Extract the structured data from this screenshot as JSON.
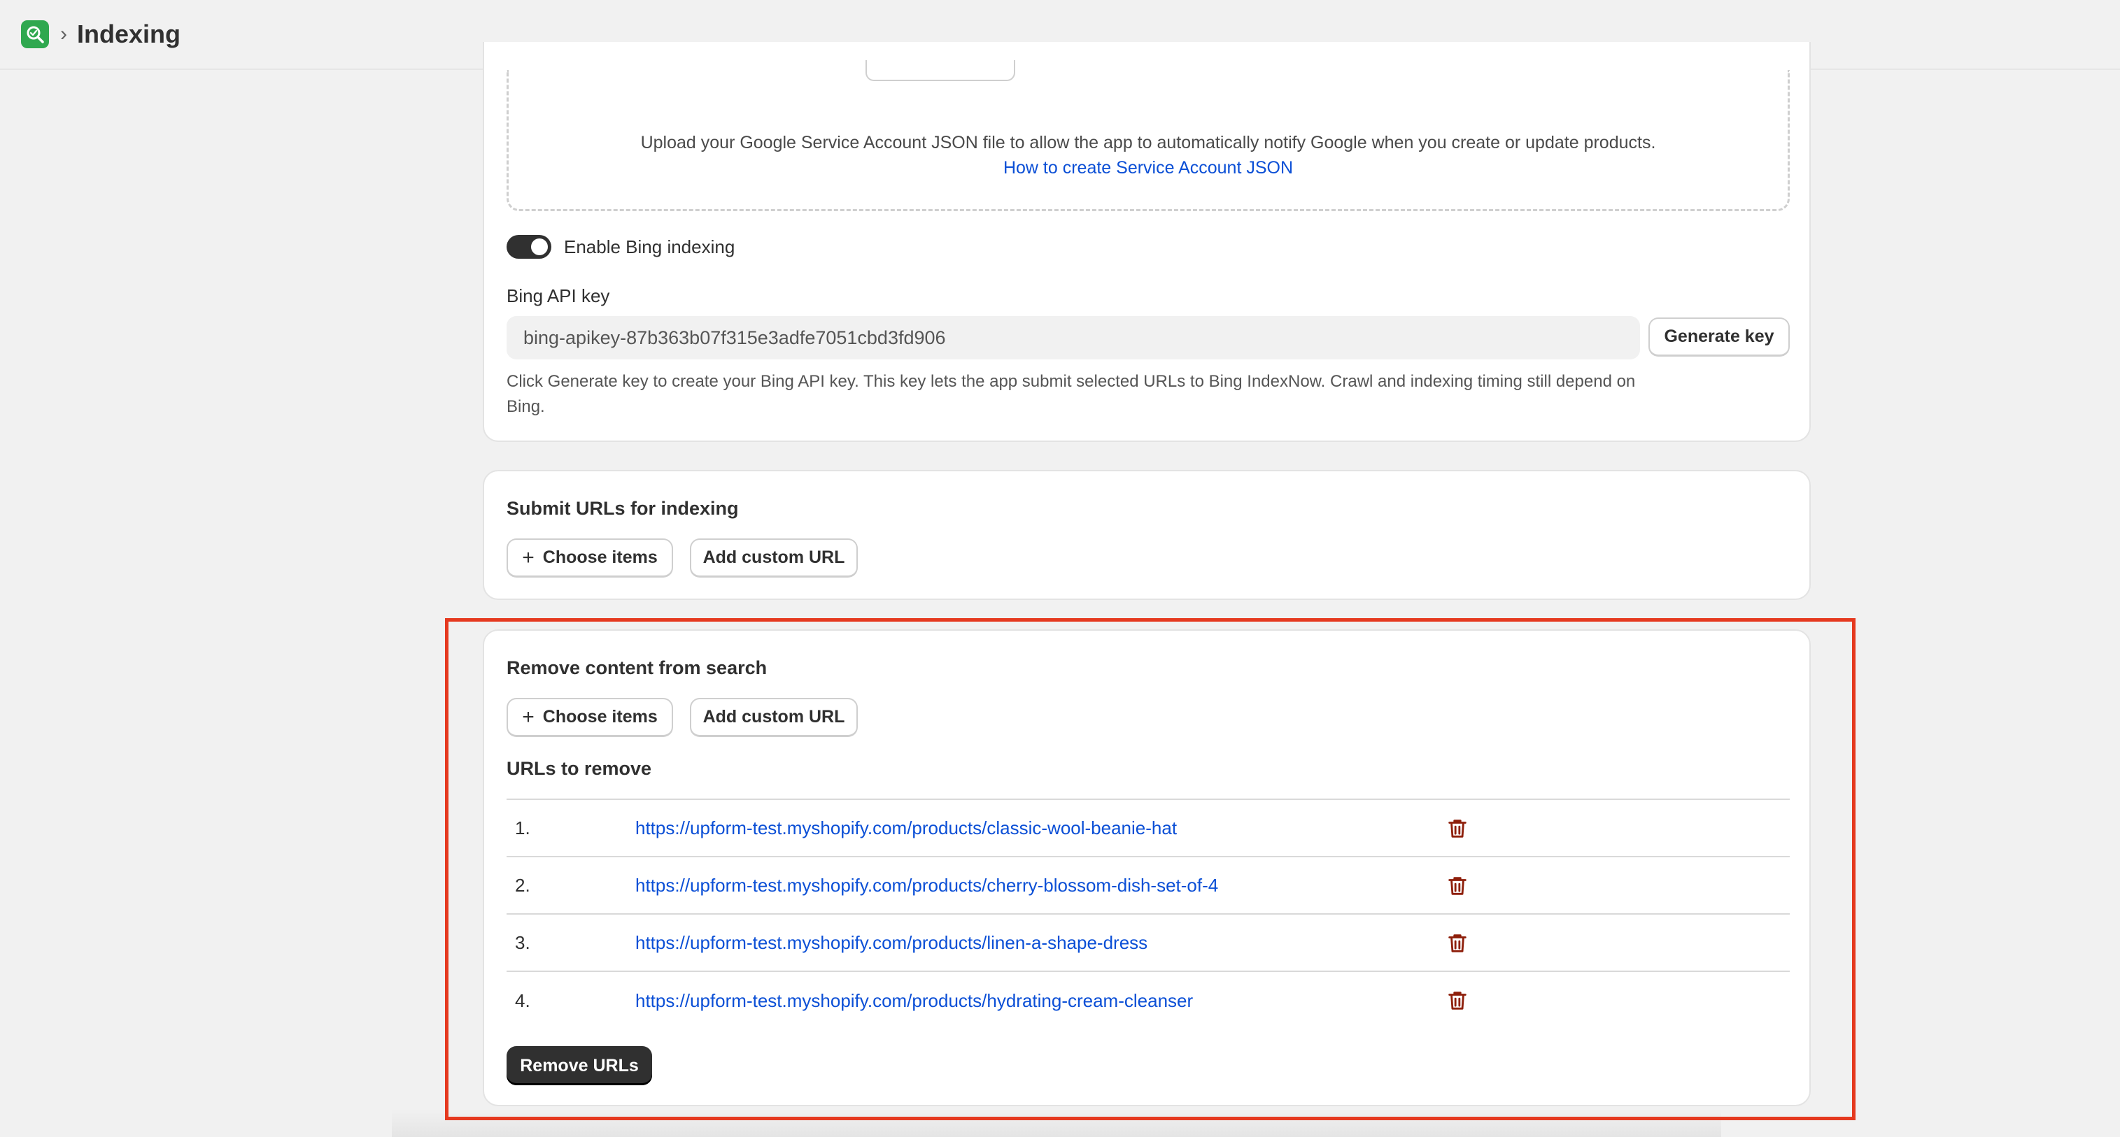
{
  "header": {
    "title": "Indexing",
    "separator": "›"
  },
  "google": {
    "upload_text": "Upload your Google Service Account JSON file to allow the app to automatically notify Google when you create or update products.",
    "help_link": "How to create Service Account JSON"
  },
  "bing": {
    "toggle_label": "Enable Bing indexing",
    "enabled": true,
    "api_key_label": "Bing API key",
    "api_key_value": "bing-apikey-87b363b07f315e3adfe7051cbd3fd906",
    "generate_label": "Generate key",
    "help_text": "Click Generate key to create your Bing API key. This key lets the app submit selected URLs to Bing IndexNow. Crawl and indexing timing still depend on Bing."
  },
  "submit": {
    "title": "Submit URLs for indexing",
    "choose_label": "Choose items",
    "custom_label": "Add custom URL"
  },
  "remove": {
    "title": "Remove content from search",
    "choose_label": "Choose items",
    "custom_label": "Add custom URL",
    "list_title": "URLs to remove",
    "urls": [
      {
        "num": "1.",
        "url": "https://upform-test.myshopify.com/products/classic-wool-beanie-hat"
      },
      {
        "num": "2.",
        "url": "https://upform-test.myshopify.com/products/cherry-blossom-dish-set-of-4"
      },
      {
        "num": "3.",
        "url": "https://upform-test.myshopify.com/products/linen-a-shape-dress"
      },
      {
        "num": "4.",
        "url": "https://upform-test.myshopify.com/products/hydrating-cream-cleanser"
      }
    ],
    "remove_label": "Remove URLs"
  },
  "colors": {
    "accent_link": "#0b4fd6",
    "danger": "#8e1f0b",
    "highlight": "#e5391f",
    "app_green": "#2fa84f"
  },
  "icons": {
    "app": "search-app-icon",
    "plus": "plus-icon",
    "delete": "trash-icon"
  }
}
